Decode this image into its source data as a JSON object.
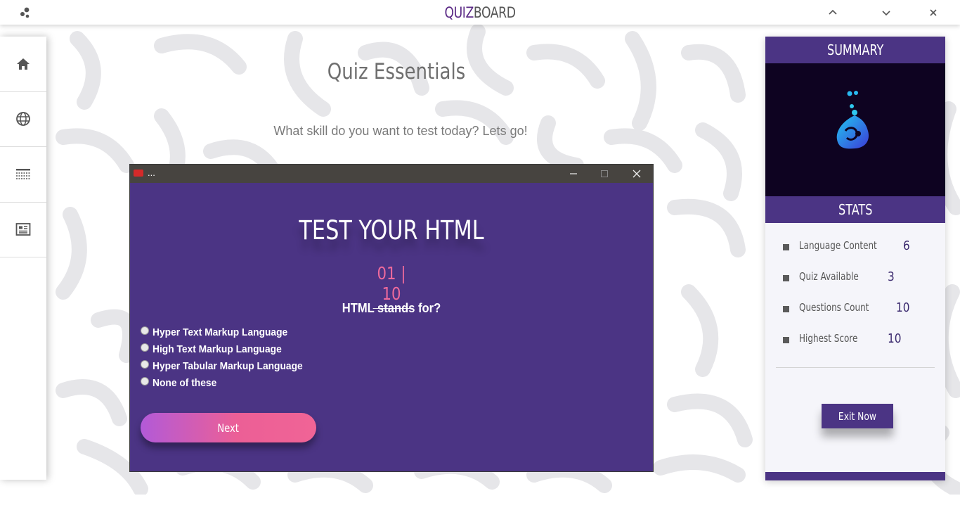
{
  "app": {
    "brand_part1": "QUIZ",
    "brand_part2": "BOARD",
    "logo_icon": "dots-logo-icon",
    "controls": [
      "chevron-up-icon",
      "chevron-down-icon",
      "close-icon"
    ]
  },
  "nav": {
    "items": [
      {
        "icon": "home-icon"
      },
      {
        "icon": "globe-icon"
      },
      {
        "icon": "list-icon"
      },
      {
        "icon": "newspaper-icon"
      }
    ]
  },
  "main": {
    "title": "Quiz Essentials",
    "subtitle": "What skill do you want to test today? Lets go!"
  },
  "quiz_window": {
    "title": "...",
    "heading": "TEST YOUR HTML",
    "counter": "01 | 10",
    "question": "HTML stands for?",
    "options": [
      "Hyper Text Markup Language",
      "High Text Markup Language",
      "Hyper Tabular Markup Language",
      "None of these"
    ],
    "next_label": "Next"
  },
  "summary": {
    "heading": "SUMMARY",
    "stats_heading": "STATS",
    "stats": [
      {
        "label": "Language Content",
        "value": "6"
      },
      {
        "label": "Quiz Available",
        "value": "3"
      },
      {
        "label": "Questions Count",
        "value": "10"
      },
      {
        "label": "Highest Score",
        "value": "10"
      }
    ],
    "exit_label": "Exit Now"
  },
  "colors": {
    "accent_purple": "#4b3484",
    "brand_purple": "#5b2a86",
    "counter_pink": "#ee6a9c",
    "button_gradient_start": "#b25ad8",
    "button_gradient_end": "#f06496"
  }
}
